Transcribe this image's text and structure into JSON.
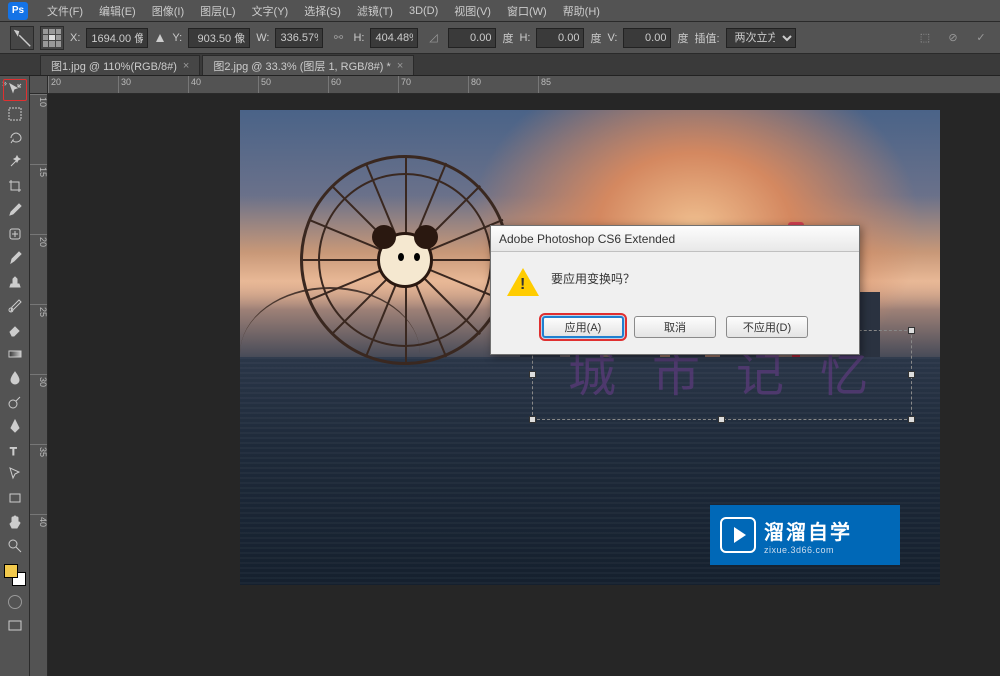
{
  "app": {
    "logo": "Ps"
  },
  "menu": [
    "文件(F)",
    "编辑(E)",
    "图像(I)",
    "图层(L)",
    "文字(Y)",
    "选择(S)",
    "滤镜(T)",
    "3D(D)",
    "视图(V)",
    "窗口(W)",
    "帮助(H)"
  ],
  "options": {
    "x_label": "X:",
    "x": "1694.00 像",
    "y_label": "Y:",
    "y": "903.50 像",
    "w_label": "W:",
    "w": "336.57%",
    "h_label": "H:",
    "h": "404.48%",
    "angle": "0.00",
    "angle_unit": "度",
    "skew_h_label": "H:",
    "skew_h": "0.00",
    "skew_h_unit": "度",
    "skew_v_label": "V:",
    "skew_v": "0.00",
    "skew_v_unit": "度",
    "interp_label": "插值:",
    "interp": "两次立方"
  },
  "tabs": [
    {
      "label": "图1.jpg @ 110%(RGB/8#)",
      "active": false
    },
    {
      "label": "图2.jpg @ 33.3% (图层 1, RGB/8#) *",
      "active": true
    }
  ],
  "ruler_h": [
    "20",
    "30",
    "40",
    "50",
    "60",
    "70",
    "80",
    "85"
  ],
  "ruler_v": [
    "10",
    "15",
    "20",
    "25",
    "30",
    "35",
    "40"
  ],
  "tools": [
    "move",
    "marquee",
    "lasso",
    "wand",
    "crop",
    "eyedropper",
    "patch",
    "brush",
    "stamp",
    "history",
    "eraser",
    "gradient",
    "blur",
    "dodge",
    "pen",
    "type",
    "path",
    "rectangle",
    "hand",
    "zoom"
  ],
  "canvas_text": "城 市   记 忆",
  "dialog": {
    "title": "Adobe Photoshop CS6 Extended",
    "message": "要应用变换吗？",
    "apply": "应用(A)",
    "cancel": "取消",
    "dont": "不应用(D)"
  },
  "brand": {
    "cn": "溜溜自学",
    "url": "zixue.3d66.com"
  }
}
